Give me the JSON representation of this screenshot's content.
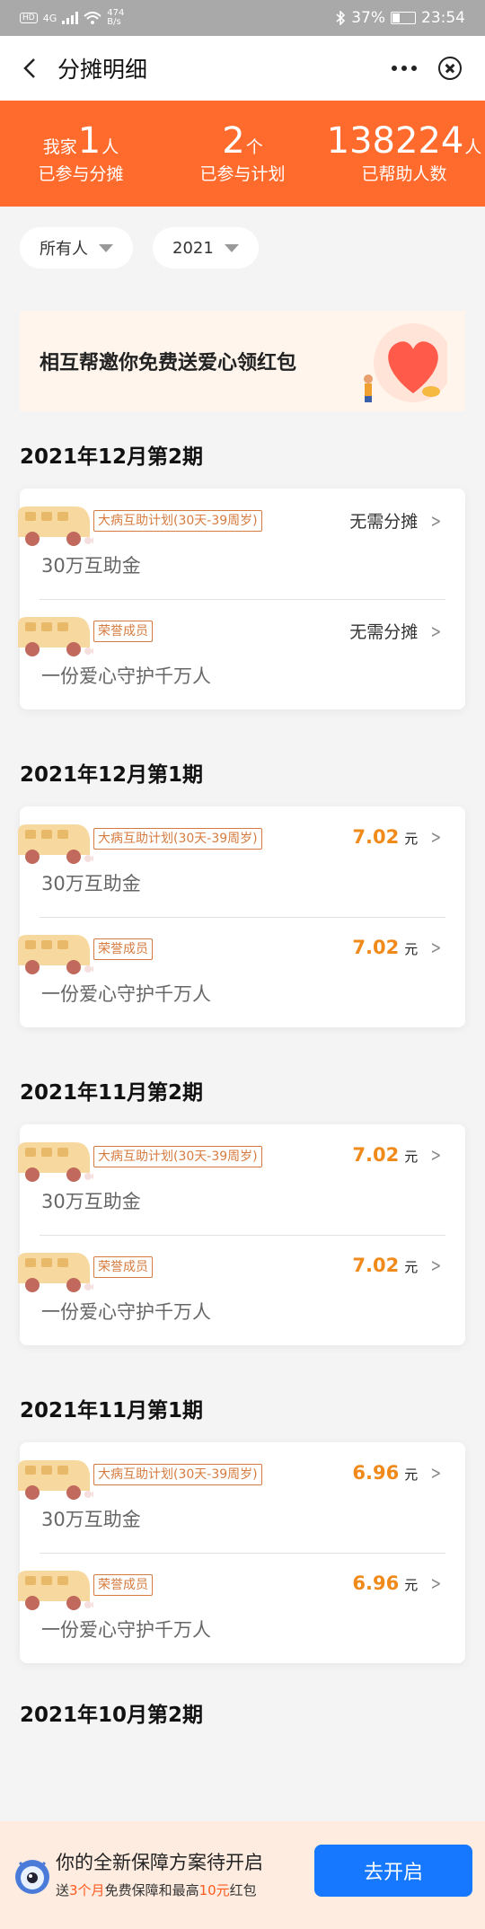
{
  "status_bar": {
    "hd": "HD",
    "network": "4G",
    "speed_value": "474",
    "speed_unit": "B/s",
    "battery_text": "37%",
    "battery_level": 0.37,
    "time": "23:54"
  },
  "nav": {
    "title": "分摊明细"
  },
  "stats": [
    {
      "prefix": "我家",
      "number": "1",
      "unit": "人",
      "label": "已参与分摊"
    },
    {
      "prefix": "",
      "number": "2",
      "unit": "个",
      "label": "已参与计划"
    },
    {
      "prefix": "",
      "number": "138224",
      "unit": "人",
      "label": "已帮助人数"
    }
  ],
  "filters": [
    {
      "label": "所有人"
    },
    {
      "label": "2021"
    }
  ],
  "banner": {
    "text": "相互帮邀你免费送爱心领红包"
  },
  "groups": [
    {
      "title": "2021年12月第2期",
      "items": [
        {
          "tag": "大病互助计划(30天-39周岁)",
          "sub": "30万互助金",
          "status": "无需分摊"
        },
        {
          "tag": "荣誉成员",
          "sub": "一份爱心守护千万人",
          "status": "无需分摊"
        }
      ]
    },
    {
      "title": "2021年12月第1期",
      "items": [
        {
          "tag": "大病互助计划(30天-39周岁)",
          "sub": "30万互助金",
          "amount": "7.02",
          "unit": "元"
        },
        {
          "tag": "荣誉成员",
          "sub": "一份爱心守护千万人",
          "amount": "7.02",
          "unit": "元"
        }
      ]
    },
    {
      "title": "2021年11月第2期",
      "items": [
        {
          "tag": "大病互助计划(30天-39周岁)",
          "sub": "30万互助金",
          "amount": "7.02",
          "unit": "元"
        },
        {
          "tag": "荣誉成员",
          "sub": "一份爱心守护千万人",
          "amount": "7.02",
          "unit": "元"
        }
      ]
    },
    {
      "title": "2021年11月第1期",
      "items": [
        {
          "tag": "大病互助计划(30天-39周岁)",
          "sub": "30万互助金",
          "amount": "6.96",
          "unit": "元"
        },
        {
          "tag": "荣誉成员",
          "sub": "一份爱心守护千万人",
          "amount": "6.96",
          "unit": "元"
        }
      ]
    }
  ],
  "partial_group_title": "2021年10月第2期",
  "bottom_bar": {
    "main_text": "你的全新保障方案待开启",
    "sub_prefix": "送",
    "sub_highlight_1": "3个月",
    "sub_middle": "免费保障和最高",
    "sub_highlight_2": "10元",
    "sub_suffix": "红包",
    "button_label": "去开启"
  },
  "colors": {
    "header_orange": "#ff6b2c",
    "amount_orange": "#f08a1b",
    "tag_orange": "#d67b3f",
    "button_blue": "#1677ff",
    "bottom_bar_bg": "#ffece0",
    "banner_bg": "#fff5ec"
  },
  "icons": {
    "back": "back-arrow-icon",
    "more": "more-dots-icon",
    "close": "close-circle-icon",
    "filter_caret": "caret-down-icon",
    "item_art": "bus-icon",
    "item_arrow": "chevron-right-icon",
    "banner_art": "heart-gift-icon",
    "mascot": "mascot-icon"
  }
}
